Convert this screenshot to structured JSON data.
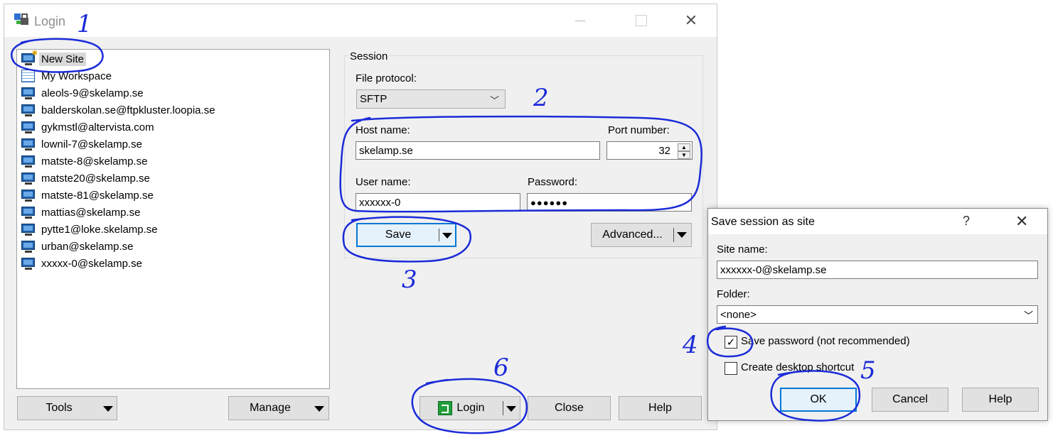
{
  "window": {
    "title": "Login"
  },
  "site_tree": {
    "items": [
      {
        "label": "New Site",
        "icon": "new-site-icon",
        "selected": true
      },
      {
        "label": "My Workspace",
        "icon": "workspace-icon"
      },
      {
        "label": "aleols-9@skelamp.se",
        "icon": "site-icon"
      },
      {
        "label": "balderskolan.se@ftpkluster.loopia.se",
        "icon": "site-icon"
      },
      {
        "label": "gykmstl@altervista.com",
        "icon": "site-icon"
      },
      {
        "label": "lownil-7@skelamp.se",
        "icon": "site-icon"
      },
      {
        "label": "matste-8@skelamp.se",
        "icon": "site-icon"
      },
      {
        "label": "matste20@skelamp.se",
        "icon": "site-icon"
      },
      {
        "label": "matste-81@skelamp.se",
        "icon": "site-icon"
      },
      {
        "label": "mattias@skelamp.se",
        "icon": "site-icon"
      },
      {
        "label": "pytte1@loke.skelamp.se",
        "icon": "site-icon"
      },
      {
        "label": "urban@skelamp.se",
        "icon": "site-icon"
      },
      {
        "label": "xxxxx-0@skelamp.se",
        "icon": "site-icon"
      }
    ]
  },
  "session": {
    "legend": "Session",
    "protocol_label": "File protocol:",
    "protocol_value": "SFTP",
    "host_label": "Host name:",
    "host_value": "skelamp.se",
    "port_label": "Port number:",
    "port_value": "32",
    "user_label": "User name:",
    "user_value": "xxxxxx-0",
    "password_label": "Password:",
    "password_value": "●●●●●●",
    "save_button": "Save",
    "advanced_button": "Advanced..."
  },
  "bottom_buttons": {
    "tools": "Tools",
    "manage": "Manage",
    "login": "Login",
    "close": "Close",
    "help": "Help"
  },
  "save_dialog": {
    "title": "Save session as site",
    "help_glyph": "?",
    "site_name_label": "Site name:",
    "site_name_value": "xxxxxx-0@skelamp.se",
    "folder_label": "Folder:",
    "folder_value": "<none>",
    "save_password_label": "Save password (not recommended)",
    "save_password_checked": true,
    "desktop_shortcut_label": "Create desktop shortcut",
    "desktop_shortcut_checked": false,
    "ok_button": "OK",
    "cancel_button": "Cancel",
    "help_button": "Help"
  },
  "annotations": {
    "numbers": [
      "1",
      "2",
      "3",
      "4",
      "5",
      "6"
    ],
    "ink_color": "#1b2bd8"
  },
  "colors": {
    "focus_border": "#0078d7",
    "selection": "#d9d9d9"
  }
}
